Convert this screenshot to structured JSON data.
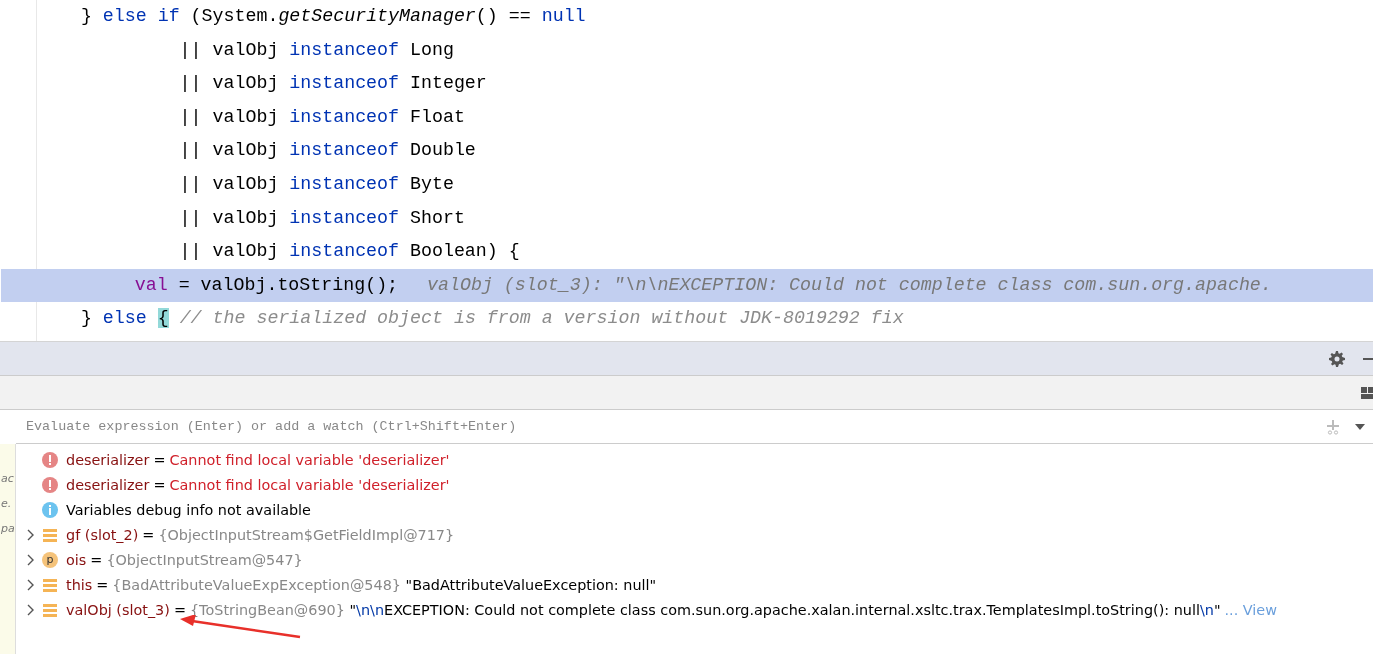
{
  "editor": {
    "lines": [
      {
        "current": false,
        "tokens": [
          {
            "kind": "plain",
            "text": "    } "
          },
          {
            "kind": "keyword",
            "text": "else if"
          },
          {
            "kind": "plain",
            "text": " (System."
          },
          {
            "kind": "static",
            "text": "getSecurityManager"
          },
          {
            "kind": "plain",
            "text": "() == "
          },
          {
            "kind": "keyword",
            "text": "null"
          }
        ]
      },
      {
        "current": false,
        "tokens": [
          {
            "kind": "plain",
            "text": "             || valObj "
          },
          {
            "kind": "keyword",
            "text": "instanceof"
          },
          {
            "kind": "plain",
            "text": " Long"
          }
        ]
      },
      {
        "current": false,
        "tokens": [
          {
            "kind": "plain",
            "text": "             || valObj "
          },
          {
            "kind": "keyword",
            "text": "instanceof"
          },
          {
            "kind": "plain",
            "text": " Integer"
          }
        ]
      },
      {
        "current": false,
        "tokens": [
          {
            "kind": "plain",
            "text": "             || valObj "
          },
          {
            "kind": "keyword",
            "text": "instanceof"
          },
          {
            "kind": "plain",
            "text": " Float"
          }
        ]
      },
      {
        "current": false,
        "tokens": [
          {
            "kind": "plain",
            "text": "             || valObj "
          },
          {
            "kind": "keyword",
            "text": "instanceof"
          },
          {
            "kind": "plain",
            "text": " Double"
          }
        ]
      },
      {
        "current": false,
        "tokens": [
          {
            "kind": "plain",
            "text": "             || valObj "
          },
          {
            "kind": "keyword",
            "text": "instanceof"
          },
          {
            "kind": "plain",
            "text": " Byte"
          }
        ]
      },
      {
        "current": false,
        "tokens": [
          {
            "kind": "plain",
            "text": "             || valObj "
          },
          {
            "kind": "keyword",
            "text": "instanceof"
          },
          {
            "kind": "plain",
            "text": " Short"
          }
        ]
      },
      {
        "current": false,
        "tokens": [
          {
            "kind": "plain",
            "text": "             || valObj "
          },
          {
            "kind": "keyword",
            "text": "instanceof"
          },
          {
            "kind": "plain",
            "text": " Boolean) {"
          }
        ]
      },
      {
        "current": true,
        "tokens": [
          {
            "kind": "local",
            "text": "        val"
          },
          {
            "kind": "plain",
            "text": " = valObj.toString();"
          },
          {
            "kind": "hint",
            "text": "valObj (slot_3): \"\\n\\nEXCEPTION: Could not complete class com.sun.org.apache."
          }
        ]
      },
      {
        "current": false,
        "tokens": [
          {
            "kind": "plain",
            "text": "    } "
          },
          {
            "kind": "keyword",
            "text": "else "
          },
          {
            "kind": "brace",
            "text": "{"
          },
          {
            "kind": "comment",
            "text": " // the serialized object is from a version without JDK-8019292 fix"
          }
        ]
      }
    ]
  },
  "frames_fragments": [
    "ac",
    "e.",
    "pa"
  ],
  "watch": {
    "placeholder": "Evaluate expression (Enter) or add a watch (Ctrl+Shift+Enter)"
  },
  "variables": [
    {
      "kind": "error",
      "expandable": false,
      "name": "deserializer",
      "separator": "=",
      "segments": [
        {
          "kind": "error",
          "text": "Cannot find local variable 'deserializer'"
        }
      ]
    },
    {
      "kind": "error",
      "expandable": false,
      "name": "deserializer",
      "separator": "=",
      "segments": [
        {
          "kind": "error",
          "text": "Cannot find local variable 'deserializer'"
        }
      ]
    },
    {
      "kind": "info",
      "expandable": false,
      "name": "Variables debug info not available"
    },
    {
      "kind": "field",
      "expandable": true,
      "name": "gf (slot_2)",
      "separator": "=",
      "segments": [
        {
          "kind": "type",
          "text": "{ObjectInputStream$GetFieldImpl@717}"
        }
      ]
    },
    {
      "kind": "param",
      "badge": "p",
      "expandable": true,
      "name": "ois",
      "separator": "=",
      "segments": [
        {
          "kind": "type",
          "text": "{ObjectInputStream@547}"
        }
      ]
    },
    {
      "kind": "field",
      "expandable": true,
      "name": "this",
      "separator": "=",
      "segments": [
        {
          "kind": "type",
          "text": "{BadAttributeValueExpException@548}"
        },
        {
          "kind": "string",
          "text": " \"BadAttributeValueException: null\""
        }
      ]
    },
    {
      "kind": "field",
      "expandable": true,
      "name": "valObj (slot_3)",
      "separator": "=",
      "segments": [
        {
          "kind": "type",
          "text": "{ToStringBean@690}"
        },
        {
          "kind": "string",
          "text": " \""
        },
        {
          "kind": "escape",
          "text": "\\n\\n"
        },
        {
          "kind": "string",
          "text": "EXCEPTION: Could not complete class com.sun.org.apache.xalan.internal.xsltc.trax.TemplatesImpl.toString(): null"
        },
        {
          "kind": "escape",
          "text": "\\n"
        },
        {
          "kind": "string",
          "text": "\""
        }
      ],
      "link": "... View"
    }
  ]
}
